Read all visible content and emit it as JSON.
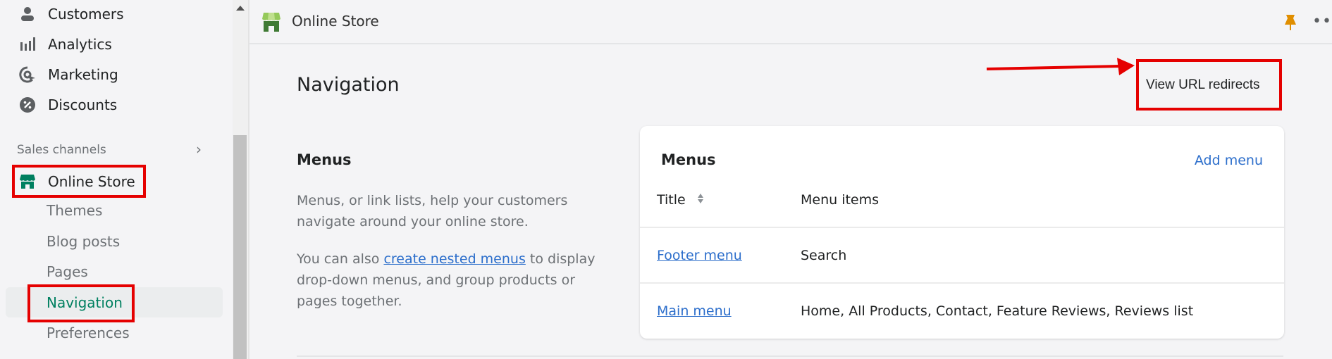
{
  "sidebar": {
    "items": [
      {
        "label": "Customers",
        "icon": "person-icon"
      },
      {
        "label": "Analytics",
        "icon": "bar-chart-icon"
      },
      {
        "label": "Marketing",
        "icon": "target-icon"
      },
      {
        "label": "Discounts",
        "icon": "discount-icon"
      }
    ],
    "section_label": "Sales channels",
    "channel": {
      "label": "Online Store",
      "icon": "store-icon"
    },
    "sub_items": [
      {
        "label": "Themes"
      },
      {
        "label": "Blog posts"
      },
      {
        "label": "Pages"
      },
      {
        "label": "Navigation",
        "active": true
      },
      {
        "label": "Preferences"
      }
    ]
  },
  "topbar": {
    "title": "Online Store"
  },
  "page": {
    "title": "Navigation",
    "secondary_action": "View URL redirects"
  },
  "menus_section": {
    "title": "Menus",
    "description": "Menus, or link lists, help your customers navigate around your online store.",
    "nested_prefix": "You can also ",
    "nested_link": "create nested menus",
    "nested_suffix": " to display drop-down menus, and group products or pages together."
  },
  "menus_card": {
    "title": "Menus",
    "add_label": "Add menu",
    "columns": [
      "Title",
      "Menu items"
    ],
    "rows": [
      {
        "title": "Footer menu",
        "items": "Search"
      },
      {
        "title": "Main menu",
        "items": "Home, All Products, Contact, Feature Reviews, Reviews list"
      }
    ]
  },
  "colors": {
    "accent_green": "#008060",
    "link_blue": "#2c6ecb",
    "annotation_red": "#e50000",
    "pin_orange": "#e08e00"
  }
}
